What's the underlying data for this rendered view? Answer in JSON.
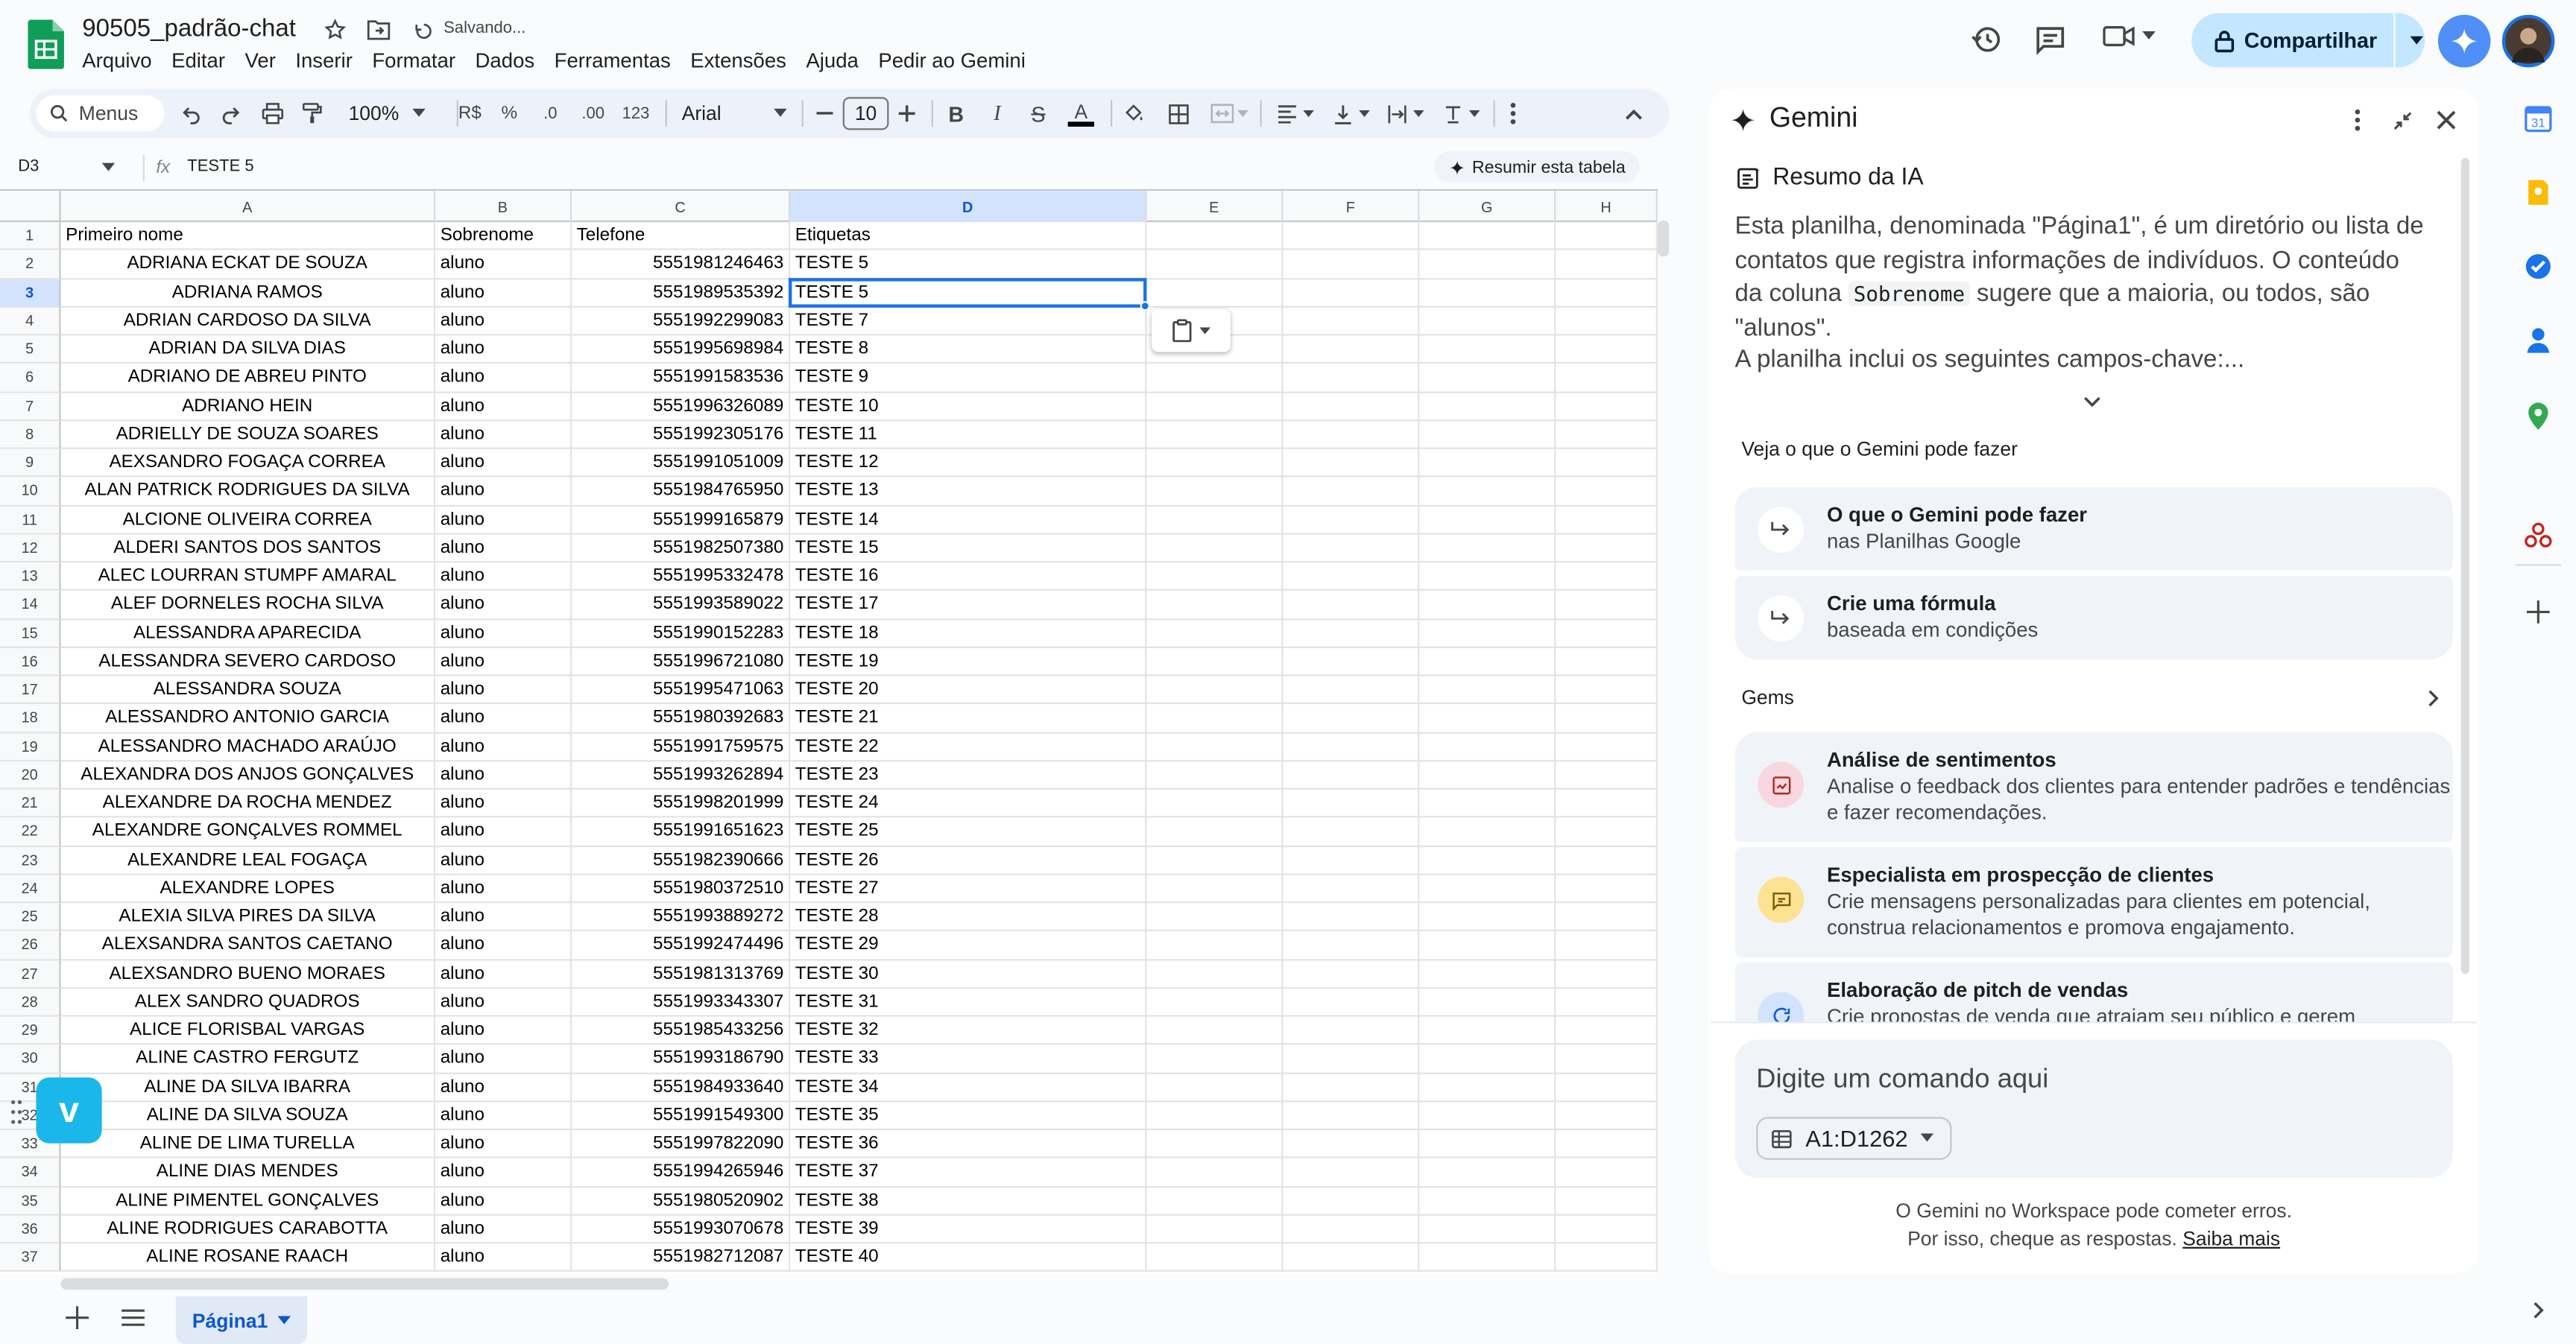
{
  "document": {
    "title": "90505_padrão-chat",
    "save_status": "Salvando..."
  },
  "menu": [
    "Arquivo",
    "Editar",
    "Ver",
    "Inserir",
    "Formatar",
    "Dados",
    "Ferramentas",
    "Extensões",
    "Ajuda",
    "Pedir ao Gemini"
  ],
  "header": {
    "share_label": "Compartilhar"
  },
  "toolbar": {
    "search_label": "Menus",
    "zoom": "100%",
    "currency": "R$",
    "percent": "%",
    "decrease_decimals": ".0",
    "increase_decimals": ".00",
    "number_format": "123",
    "font_family": "Arial",
    "font_size": "10"
  },
  "formula_bar": {
    "cell_ref": "D3",
    "fx": "fx",
    "value": "TESTE 5",
    "summarize_label": "Resumir esta tabela"
  },
  "grid": {
    "columns": [
      "A",
      "B",
      "C",
      "D",
      "E",
      "F",
      "G",
      "H"
    ],
    "selected_column": "D",
    "selected_row": 3,
    "header_row": [
      "Primeiro nome",
      "Sobrenome",
      "Telefone",
      "Etiquetas"
    ],
    "rows": [
      [
        "ADRIANA ECKAT DE SOUZA",
        "aluno",
        "5551981246463",
        "TESTE 5"
      ],
      [
        "ADRIANA RAMOS",
        "aluno",
        "5551989535392",
        "TESTE 5"
      ],
      [
        "ADRIAN CARDOSO DA SILVA",
        "aluno",
        "5551992299083",
        "TESTE 7"
      ],
      [
        "ADRIAN DA SILVA DIAS",
        "aluno",
        "5551995698984",
        "TESTE 8"
      ],
      [
        "ADRIANO DE ABREU PINTO",
        "aluno",
        "5551991583536",
        "TESTE 9"
      ],
      [
        "ADRIANO HEIN",
        "aluno",
        "5551996326089",
        "TESTE 10"
      ],
      [
        "ADRIELLY DE SOUZA SOARES",
        "aluno",
        "5551992305176",
        "TESTE 11"
      ],
      [
        "AEXSANDRO FOGAÇA CORREA",
        "aluno",
        "5551991051009",
        "TESTE 12"
      ],
      [
        "ALAN PATRICK RODRIGUES DA SILVA",
        "aluno",
        "5551984765950",
        "TESTE 13"
      ],
      [
        "ALCIONE OLIVEIRA CORREA",
        "aluno",
        "5551999165879",
        "TESTE 14"
      ],
      [
        "ALDERI SANTOS DOS SANTOS",
        "aluno",
        "5551982507380",
        "TESTE 15"
      ],
      [
        "ALEC LOURRAN STUMPF AMARAL",
        "aluno",
        "5551995332478",
        "TESTE 16"
      ],
      [
        "ALEF DORNELES ROCHA SILVA",
        "aluno",
        "5551993589022",
        "TESTE 17"
      ],
      [
        "ALESSANDRA APARECIDA",
        "aluno",
        "5551990152283",
        "TESTE 18"
      ],
      [
        "ALESSANDRA SEVERO CARDOSO",
        "aluno",
        "5551996721080",
        "TESTE 19"
      ],
      [
        "ALESSANDRA SOUZA",
        "aluno",
        "5551995471063",
        "TESTE 20"
      ],
      [
        "ALESSANDRO ANTONIO GARCIA",
        "aluno",
        "5551980392683",
        "TESTE 21"
      ],
      [
        "ALESSANDRO MACHADO ARAÚJO",
        "aluno",
        "5551991759575",
        "TESTE 22"
      ],
      [
        "ALEXANDRA DOS ANJOS GONÇALVES",
        "aluno",
        "5551993262894",
        "TESTE 23"
      ],
      [
        "ALEXANDRE DA ROCHA MENDEZ",
        "aluno",
        "5551998201999",
        "TESTE 24"
      ],
      [
        "ALEXANDRE GONÇALVES ROMMEL",
        "aluno",
        "5551991651623",
        "TESTE 25"
      ],
      [
        "ALEXANDRE LEAL FOGAÇA",
        "aluno",
        "5551982390666",
        "TESTE 26"
      ],
      [
        "ALEXANDRE LOPES",
        "aluno",
        "5551980372510",
        "TESTE 27"
      ],
      [
        "ALEXIA SILVA PIRES DA SILVA",
        "aluno",
        "5551993889272",
        "TESTE 28"
      ],
      [
        "ALEXSANDRA SANTOS CAETANO",
        "aluno",
        "5551992474496",
        "TESTE 29"
      ],
      [
        "ALEXSANDRO BUENO MORAES",
        "aluno",
        "5551981313769",
        "TESTE 30"
      ],
      [
        "ALEX SANDRO QUADROS",
        "aluno",
        "5551993343307",
        "TESTE 31"
      ],
      [
        "ALICE FLORISBAL VARGAS",
        "aluno",
        "5551985433256",
        "TESTE 32"
      ],
      [
        "ALINE CASTRO FERGUTZ",
        "aluno",
        "5551993186790",
        "TESTE 33"
      ],
      [
        "ALINE DA SILVA IBARRA",
        "aluno",
        "5551984933640",
        "TESTE 34"
      ],
      [
        "ALINE DA SILVA SOUZA",
        "aluno",
        "5551991549300",
        "TESTE 35"
      ],
      [
        "ALINE DE LIMA TURELLA",
        "aluno",
        "5551997822090",
        "TESTE 36"
      ],
      [
        "ALINE DIAS MENDES",
        "aluno",
        "5551994265946",
        "TESTE 37"
      ],
      [
        "ALINE PIMENTEL GONÇALVES",
        "aluno",
        "5551980520902",
        "TESTE 38"
      ],
      [
        "ALINE RODRIGUES CARABOTTA",
        "aluno",
        "5551993070678",
        "TESTE 39"
      ],
      [
        "ALINE ROSANE RAACH",
        "aluno",
        "5551982712087",
        "TESTE 40"
      ]
    ]
  },
  "sheets": {
    "active_tab": "Página1"
  },
  "gemini": {
    "title": "Gemini",
    "summary_title": "Resumo da IA",
    "summary_part1": "Esta planilha, denominada \"Página1\", é um diretório ou lista de contatos que registra informações de indivíduos. O conteúdo da coluna ",
    "summary_code": "Sobrenome",
    "summary_part2": " sugere que a maioria, ou todos, são \"alunos\".",
    "summary_more": "A planilha inclui os seguintes campos-chave:...",
    "can_do_title": "Veja o que o Gemini pode fazer",
    "suggestions": [
      {
        "title": "O que o Gemini pode fazer",
        "subtitle": "nas Planilhas Google"
      },
      {
        "title": "Crie uma fórmula",
        "subtitle": "baseada em condições"
      }
    ],
    "gems_title": "Gems",
    "gems": [
      {
        "title": "Análise de sentimentos",
        "subtitle": "Analise o feedback dos clientes para entender padrões e tendências e fazer recomendações."
      },
      {
        "title": "Especialista em prospecção de clientes",
        "subtitle": "Crie mensagens personalizadas para clientes em potencial, construa relacionamentos e promova engajamento."
      },
      {
        "title": "Elaboração de pitch de vendas",
        "subtitle": "Crie propostas de venda que atraiam seu público e gerem"
      }
    ],
    "prompt_placeholder": "Digite um comando aqui",
    "range": "A1:D1262",
    "disclaimer_line1": "O Gemini no Workspace pode cometer erros.",
    "disclaimer_line2": "Por isso, cheque as respostas.",
    "learn_more": "Saiba mais"
  },
  "colors": {
    "accent": "#0b57d0",
    "share_bg": "#c2e7ff",
    "selection": "#1a73e8",
    "sheets_green": "#0f9d58"
  }
}
